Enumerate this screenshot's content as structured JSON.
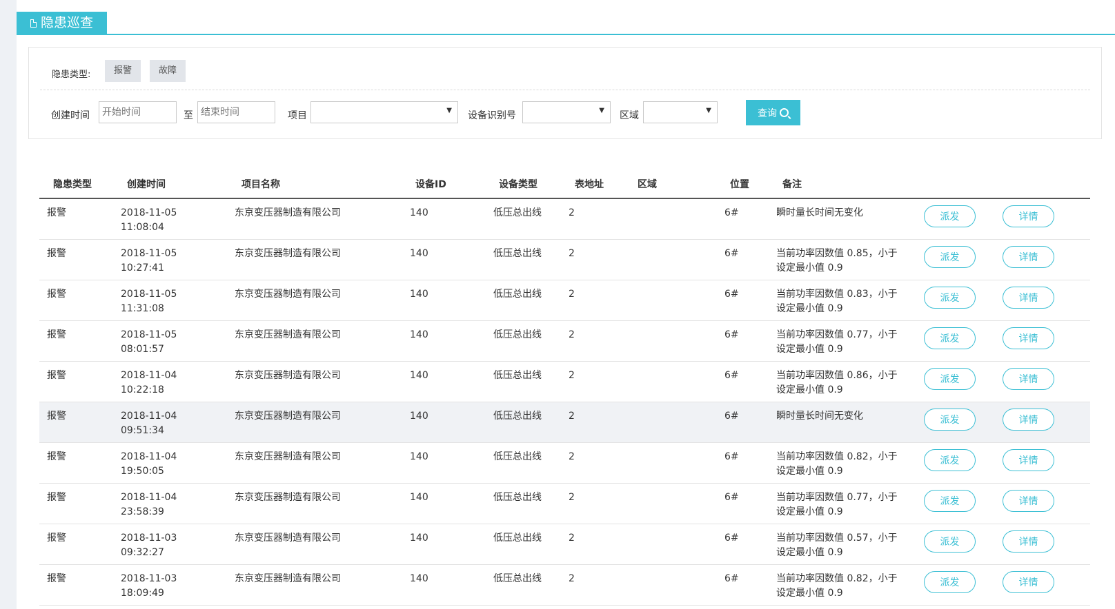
{
  "page": {
    "title": "隐患巡查"
  },
  "filter": {
    "type_label": "隐患类型:",
    "type_chips": [
      "报警",
      "故障"
    ],
    "created_label": "创建时间",
    "start_placeholder": "开始时间",
    "to_label": "至",
    "end_placeholder": "结束时间",
    "project_label": "项目",
    "project_value": "",
    "device_label": "设备识别号",
    "device_value": "",
    "area_label": "区域",
    "area_value": "",
    "search_label": "查询"
  },
  "table": {
    "headers": [
      "隐患类型",
      "创建时间",
      "项目名称",
      "设备ID",
      "设备类型",
      "表地址",
      "区域",
      "位置",
      "备注",
      "",
      ""
    ],
    "dispatch_label": "派发",
    "detail_label": "详情",
    "rows": [
      {
        "type": "报警",
        "date": "2018-11-05",
        "time": "11:08:04",
        "project": "东京变压器制造有限公司",
        "device_id": "140",
        "device_type": "低压总出线",
        "address": "2",
        "area": "",
        "position": "6#",
        "remark1": "瞬时量长时间无变化",
        "remark2": ""
      },
      {
        "type": "报警",
        "date": "2018-11-05",
        "time": "10:27:41",
        "project": "东京变压器制造有限公司",
        "device_id": "140",
        "device_type": "低压总出线",
        "address": "2",
        "area": "",
        "position": "6#",
        "remark1": "当前功率因数值 0.85，小于",
        "remark2": "设定最小值 0.9"
      },
      {
        "type": "报警",
        "date": "2018-11-05",
        "time": "11:31:08",
        "project": "东京变压器制造有限公司",
        "device_id": "140",
        "device_type": "低压总出线",
        "address": "2",
        "area": "",
        "position": "6#",
        "remark1": "当前功率因数值 0.83，小于",
        "remark2": "设定最小值 0.9"
      },
      {
        "type": "报警",
        "date": "2018-11-05",
        "time": "08:01:57",
        "project": "东京变压器制造有限公司",
        "device_id": "140",
        "device_type": "低压总出线",
        "address": "2",
        "area": "",
        "position": "6#",
        "remark1": "当前功率因数值 0.77，小于",
        "remark2": "设定最小值 0.9"
      },
      {
        "type": "报警",
        "date": "2018-11-04",
        "time": "10:22:18",
        "project": "东京变压器制造有限公司",
        "device_id": "140",
        "device_type": "低压总出线",
        "address": "2",
        "area": "",
        "position": "6#",
        "remark1": "当前功率因数值 0.86，小于",
        "remark2": "设定最小值 0.9"
      },
      {
        "type": "报警",
        "date": "2018-11-04",
        "time": "09:51:34",
        "project": "东京变压器制造有限公司",
        "device_id": "140",
        "device_type": "低压总出线",
        "address": "2",
        "area": "",
        "position": "6#",
        "remark1": "瞬时量长时间无变化",
        "remark2": ""
      },
      {
        "type": "报警",
        "date": "2018-11-04",
        "time": "19:50:05",
        "project": "东京变压器制造有限公司",
        "device_id": "140",
        "device_type": "低压总出线",
        "address": "2",
        "area": "",
        "position": "6#",
        "remark1": "当前功率因数值 0.82，小于",
        "remark2": "设定最小值 0.9"
      },
      {
        "type": "报警",
        "date": "2018-11-04",
        "time": "23:58:39",
        "project": "东京变压器制造有限公司",
        "device_id": "140",
        "device_type": "低压总出线",
        "address": "2",
        "area": "",
        "position": "6#",
        "remark1": "当前功率因数值 0.77，小于",
        "remark2": "设定最小值 0.9"
      },
      {
        "type": "报警",
        "date": "2018-11-03",
        "time": "09:32:27",
        "project": "东京变压器制造有限公司",
        "device_id": "140",
        "device_type": "低压总出线",
        "address": "2",
        "area": "",
        "position": "6#",
        "remark1": "当前功率因数值 0.57，小于",
        "remark2": "设定最小值 0.9"
      },
      {
        "type": "报警",
        "date": "2018-11-03",
        "time": "18:09:49",
        "project": "东京变压器制造有限公司",
        "device_id": "140",
        "device_type": "低压总出线",
        "address": "2",
        "area": "",
        "position": "6#",
        "remark1": "当前功率因数值 0.82，小于",
        "remark2": "设定最小值 0.9"
      }
    ],
    "highlighted_row": 5
  },
  "colors": {
    "accent": "#3bbfd4",
    "chip_bg": "#e2e5ea",
    "highlight_row": "#f0f2f5"
  }
}
